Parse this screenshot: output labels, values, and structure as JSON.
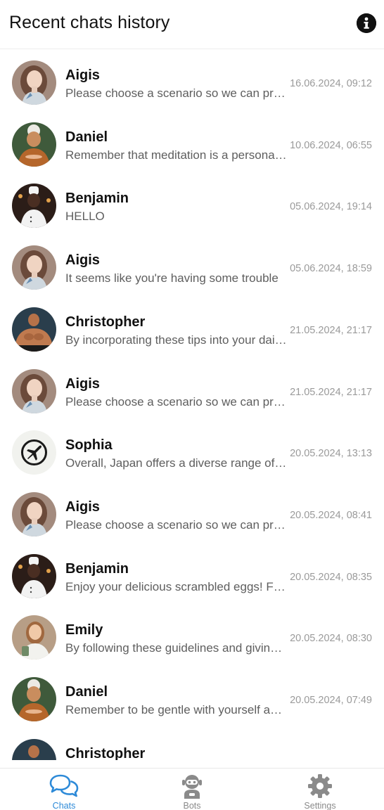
{
  "header": {
    "title": "Recent chats history",
    "info_icon": "info-icon"
  },
  "chats": [
    {
      "name": "Aigis",
      "preview": "Please choose a scenario so we can provide the best help",
      "time": "16.06.2024, 09:12",
      "avatar": "aigis"
    },
    {
      "name": "Daniel",
      "preview": "Remember that meditation is a personal journey",
      "time": "10.06.2024, 06:55",
      "avatar": "daniel"
    },
    {
      "name": "Benjamin",
      "preview": "HELLO",
      "time": "05.06.2024, 19:14",
      "avatar": "benjamin"
    },
    {
      "name": "Aigis",
      "preview": "It seems like you're having some trouble",
      "time": "05.06.2024, 18:59",
      "avatar": "aigis"
    },
    {
      "name": "Christopher",
      "preview": "By incorporating these tips into your daily routine",
      "time": "21.05.2024, 21:17",
      "avatar": "christopher"
    },
    {
      "name": "Aigis",
      "preview": "Please choose a scenario so we can provide the best help",
      "time": "21.05.2024, 21:17",
      "avatar": "aigis"
    },
    {
      "name": "Sophia",
      "preview": "Overall, Japan offers a diverse range of experiences",
      "time": "20.05.2024, 13:13",
      "avatar": "sophia"
    },
    {
      "name": "Aigis",
      "preview": "Please choose a scenario so we can provide the best help",
      "time": "20.05.2024, 08:41",
      "avatar": "aigis"
    },
    {
      "name": "Benjamin",
      "preview": "Enjoy your delicious scrambled eggs! Feel free to ask",
      "time": "20.05.2024, 08:35",
      "avatar": "benjamin"
    },
    {
      "name": "Emily",
      "preview": "By following these guidelines and giving your best",
      "time": "20.05.2024, 08:30",
      "avatar": "emily"
    },
    {
      "name": "Daniel",
      "preview": "Remember to be gentle with yourself and patient",
      "time": "20.05.2024, 07:49",
      "avatar": "daniel"
    },
    {
      "name": "Christopher",
      "preview": "",
      "time": "",
      "avatar": "christopher"
    }
  ],
  "tabs": [
    {
      "label": "Chats",
      "icon": "chat-bubbles-icon",
      "active": true
    },
    {
      "label": "Bots",
      "icon": "robot-icon",
      "active": false
    },
    {
      "label": "Settings",
      "icon": "gear-icon",
      "active": false
    }
  ],
  "colors": {
    "accent": "#2d8ad8",
    "inactive": "#8a8a8a",
    "time": "#9a9a9a",
    "preview": "#5e5e5e"
  }
}
